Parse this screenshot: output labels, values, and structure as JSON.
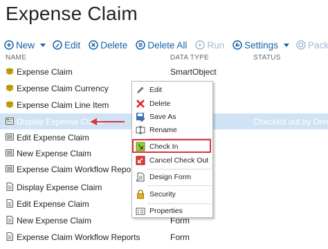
{
  "page": {
    "title": "Expense Claim"
  },
  "toolbar": {
    "new_label": "New",
    "edit_label": "Edit",
    "delete_label": "Delete",
    "delete_all_label": "Delete All",
    "run_label": "Run",
    "settings_label": "Settings",
    "package_label": "Package"
  },
  "columns": {
    "name": "NAME",
    "data_type": "DATA TYPE",
    "status": "STATUS"
  },
  "rows": [
    {
      "name": "Expense Claim",
      "type": "SmartObject",
      "status": "",
      "icon": "smartobject-icon"
    },
    {
      "name": "Expense Claim Currency",
      "type": "",
      "status": "",
      "icon": "smartobject-icon"
    },
    {
      "name": "Expense Claim Line Item",
      "type": "",
      "status": "",
      "icon": "smartobject-icon"
    },
    {
      "name": "Display Expense Claim",
      "type": "",
      "status": "Checked out by Denallo",
      "icon": "view-icon"
    },
    {
      "name": "Edit Expense Claim",
      "type": "",
      "status": "",
      "icon": "view-icon"
    },
    {
      "name": "New Expense Claim",
      "type": "",
      "status": "",
      "icon": "view-icon"
    },
    {
      "name": "Expense Claim Workflow Reports",
      "type": "",
      "status": "",
      "icon": "view-icon"
    },
    {
      "name": "Display Expense Claim",
      "type": "",
      "status": "",
      "icon": "form-icon"
    },
    {
      "name": "Edit Expense Claim",
      "type": "",
      "status": "",
      "icon": "form-icon"
    },
    {
      "name": "New Expense Claim",
      "type": "Form",
      "status": "",
      "icon": "form-icon"
    },
    {
      "name": "Expense Claim Workflow Reports",
      "type": "Form",
      "status": "",
      "icon": "form-icon"
    }
  ],
  "context_menu": {
    "edit": "Edit",
    "delete": "Delete",
    "save_as": "Save As",
    "rename": "Rename",
    "check_in": "Check In",
    "cancel_check_out": "Cancel Check Out",
    "design_form": "Design Form",
    "security": "Security",
    "properties": "Properties"
  },
  "colors": {
    "accent": "#1560a8",
    "selected_row": "#cfe3f5",
    "highlight_border": "#d9343b",
    "arrow": "#d9343b"
  }
}
